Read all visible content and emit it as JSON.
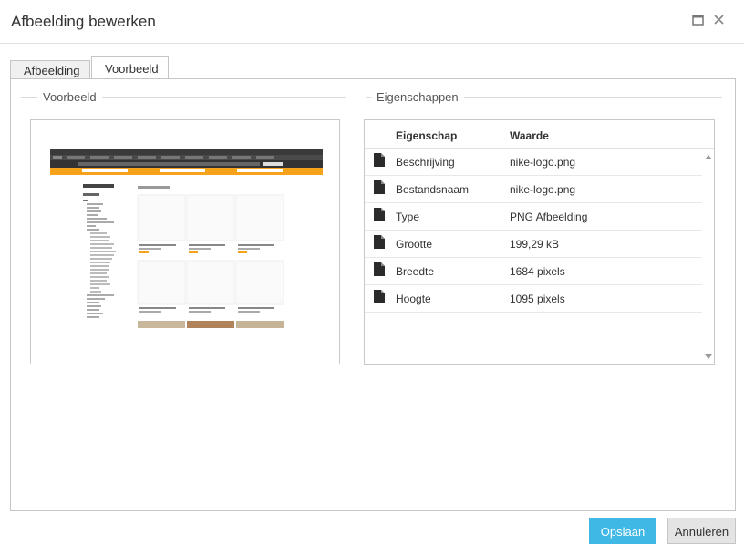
{
  "window": {
    "title": "Afbeelding bewerken"
  },
  "tabs": [
    {
      "label": "Afbeelding",
      "active": false
    },
    {
      "label": "Voorbeeld",
      "active": true
    }
  ],
  "preview": {
    "legend": "Voorbeeld"
  },
  "properties": {
    "legend": "Eigenschappen",
    "columns": [
      "Eigenschap",
      "Waarde"
    ],
    "rows": [
      {
        "key": "Beschrijving",
        "value": "nike-logo.png"
      },
      {
        "key": "Bestandsnaam",
        "value": "nike-logo.png"
      },
      {
        "key": "Type",
        "value": "PNG Afbeelding"
      },
      {
        "key": "Grootte",
        "value": "199,29 kB"
      },
      {
        "key": "Breedte",
        "value": "1684 pixels"
      },
      {
        "key": "Hoogte",
        "value": "1095 pixels"
      }
    ]
  },
  "footer": {
    "save_label": "Opslaan",
    "cancel_label": "Annuleren"
  },
  "colors": {
    "accent": "#3fb8e6",
    "thumb_orange": "#f7a21b",
    "thumb_dark": "#333333"
  }
}
